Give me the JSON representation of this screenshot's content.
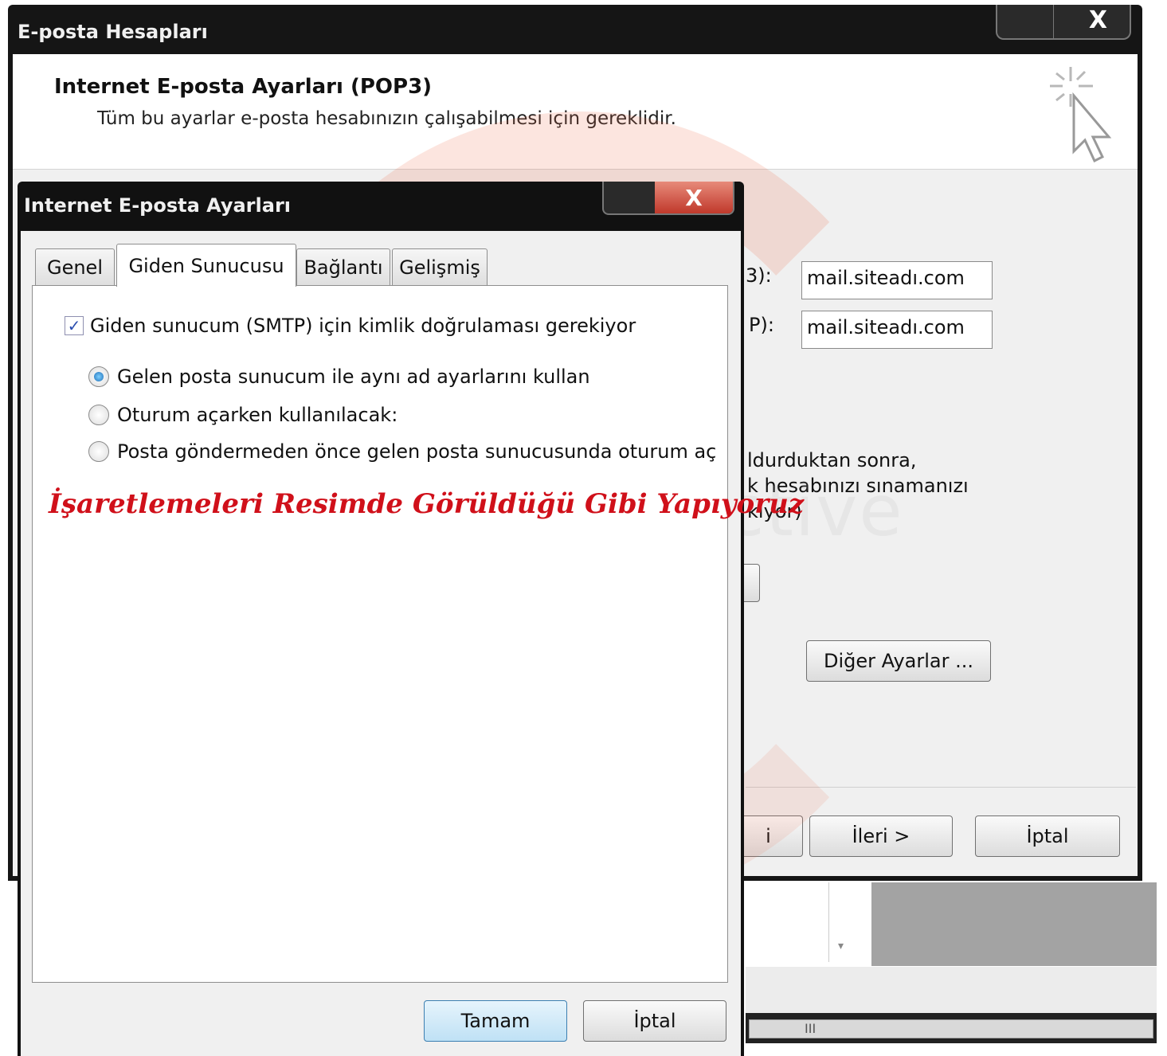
{
  "outer_window": {
    "title": "E-posta Hesapları",
    "close_label": "X",
    "header_title": "Internet E-posta Ayarları (POP3)",
    "header_subtitle": "Tüm bu ayarlar e-posta hesabınızın çalışabilmesi için gereklidir.",
    "incoming_label_partial": "3):",
    "outgoing_label_partial": "P):",
    "incoming_server": "mail.siteadı.com",
    "outgoing_server": "mail.siteadı.com",
    "test_text_line1": "ldurduktan sonra,",
    "test_text_line2": "k hesabınızı sınamanızı",
    "test_text_line3": "kiyor)",
    "more_settings_label": "Diğer Ayarlar ...",
    "back_partial_label": "i",
    "next_label": "İleri >",
    "cancel_label": "İptal"
  },
  "dialog": {
    "title": "Internet E-posta Ayarları",
    "close_label": "X",
    "tabs": [
      {
        "label": "Genel",
        "active": false
      },
      {
        "label": "Giden Sunucusu",
        "active": true
      },
      {
        "label": "Bağlantı",
        "active": false
      },
      {
        "label": "Gelişmiş",
        "active": false
      }
    ],
    "smtp_auth_checkbox": {
      "label": "Giden sunucum (SMTP) için kimlik doğrulaması gerekiyor",
      "checked": true
    },
    "radio_options": [
      {
        "label": "Gelen posta sunucum ile aynı ad ayarlarını kullan",
        "selected": true
      },
      {
        "label": "Oturum açarken kullanılacak:",
        "selected": false
      },
      {
        "label": "Posta göndermeden önce gelen posta sunucusunda oturum aç",
        "selected": false
      }
    ],
    "annotation": "İşaretlemeleri Resimde Görüldüğü Gibi Yapıyoruz",
    "ok_label": "Tamam",
    "cancel_label": "İptal"
  },
  "watermark": "interactive",
  "background_scroll_grip": "III",
  "colors": {
    "titlebar": "#151515",
    "annotation_red": "#d0101a",
    "close_red": "#c0392b"
  }
}
